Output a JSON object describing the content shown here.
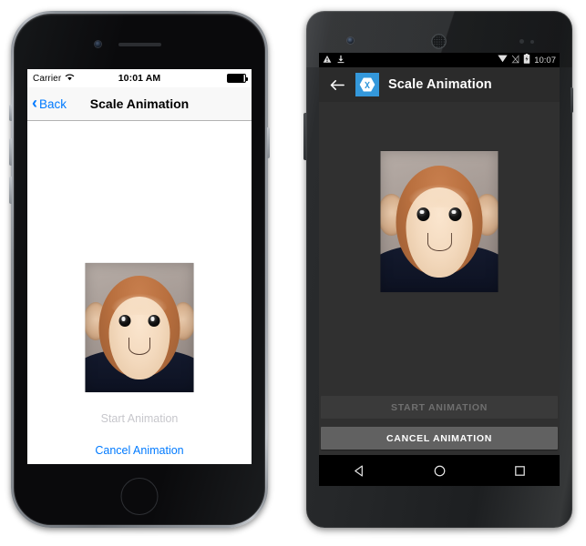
{
  "page": {
    "title": "Scale Animation",
    "description": "Side-by-side iOS and Android screenshots of a Scale Animation demo app"
  },
  "ios": {
    "device_name": "iPhone",
    "status_bar": {
      "carrier": "Carrier",
      "wifi_icon": "wifi-icon",
      "time": "10:01 AM",
      "battery_icon": "battery-full-icon"
    },
    "nav_bar": {
      "back_label": "Back",
      "back_chevron_icon": "chevron-left-icon",
      "title": "Scale Animation"
    },
    "image": {
      "alt": "monkey-photo",
      "name": "monkey-image"
    },
    "buttons": {
      "start": {
        "label": "Start Animation",
        "enabled": false,
        "color": "#c7c7cc"
      },
      "cancel": {
        "label": "Cancel Animation",
        "enabled": true,
        "color": "#007aff"
      }
    },
    "home_button_icon": "home-button-icon"
  },
  "android": {
    "device_name": "Android",
    "status_bar": {
      "warning_icon": "warning-triangle-icon",
      "download_icon": "download-icon",
      "wifi_icon": "wifi-icon",
      "signal_icon": "signal-no-sim-icon",
      "battery_icon": "battery-charging-icon",
      "time": "10:07"
    },
    "app_bar": {
      "back_icon": "arrow-left-icon",
      "logo_icon": "xamarin-logo-icon",
      "logo_color": "#3498db",
      "title": "Scale Animation"
    },
    "image": {
      "alt": "monkey-photo",
      "name": "monkey-image"
    },
    "buttons": {
      "start": {
        "label": "START ANIMATION",
        "enabled": false,
        "bg": "#3a3a3a",
        "color": "#6f6f6f"
      },
      "cancel": {
        "label": "CANCEL ANIMATION",
        "enabled": true,
        "bg": "#616161",
        "color": "#ffffff"
      }
    },
    "nav_bar": {
      "back_icon": "nav-back-triangle-icon",
      "home_icon": "nav-home-circle-icon",
      "recents_icon": "nav-recents-square-icon"
    }
  },
  "colors": {
    "ios_accent": "#007aff",
    "ios_disabled": "#c7c7cc",
    "android_accent": "#3498db",
    "android_surface": "#303030",
    "android_appbar": "#2b2b2b"
  }
}
